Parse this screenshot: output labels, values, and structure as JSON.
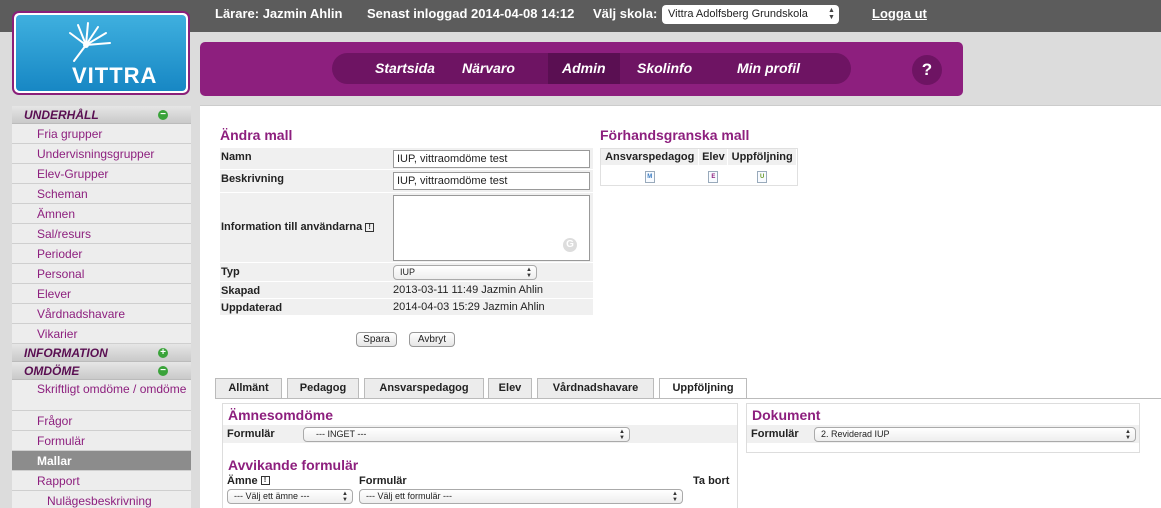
{
  "topbar": {
    "teacher": "Lärare: Jazmin Ahlin",
    "last_login": "Senast inloggad 2014-04-08 14:12",
    "school_label": "Välj skola:",
    "school_value": "Vittra Adolfsberg Grundskola",
    "logout": "Logga ut"
  },
  "logo": {
    "text": "VITTRA"
  },
  "nav": {
    "items": [
      "Startsida",
      "Närvaro",
      "Admin",
      "Skolinfo",
      "Min profil"
    ],
    "help": "?"
  },
  "sidebar": {
    "sections": [
      {
        "title": "UNDERHÅLL",
        "icon": "minus",
        "items": [
          "Fria grupper",
          "Undervisningsgrupper",
          "Elev-Grupper",
          "Scheman",
          "Ämnen",
          "Sal/resurs",
          "Perioder",
          "Personal",
          "Elever",
          "Vårdnadshavare",
          "Vikarier"
        ]
      },
      {
        "title": "INFORMATION",
        "icon": "plus",
        "items": []
      },
      {
        "title": "OMDÖME",
        "icon": "minus",
        "items": [
          "Skriftligt omdöme / omdöme",
          "Frågor",
          "Formulär",
          "Mallar",
          "Rapport",
          "Nulägesbeskrivning"
        ]
      }
    ],
    "active_item": "Mallar"
  },
  "edit": {
    "title": "Ändra mall",
    "name_label": "Namn",
    "name_value": "IUP, vittraomdöme test",
    "desc_label": "Beskrivning",
    "desc_value": "IUP, vittraomdöme test",
    "info_label": "Information till användarna",
    "info_icon": "!",
    "type_label": "Typ",
    "type_value": "IUP",
    "created_label": "Skapad",
    "created_value": "2013-03-11 11:49 Jazmin Ahlin",
    "updated_label": "Uppdaterad",
    "updated_value": "2014-04-03 15:29 Jazmin Ahlin",
    "save": "Spara",
    "cancel": "Avbryt"
  },
  "preview": {
    "title": "Förhandsgranska mall",
    "columns": [
      "Ansvarspedagog",
      "Elev",
      "Uppföljning"
    ],
    "letters": [
      "M",
      "E",
      "U"
    ]
  },
  "tabs": [
    "Allmänt",
    "Pedagog",
    "Ansvarspedagog",
    "Elev",
    "Vårdnadshavare",
    "Uppföljning"
  ],
  "active_tab": "Uppföljning",
  "subject": {
    "title": "Ämnesomdöme",
    "form_label": "Formulär",
    "form_value": "--- INGET ---"
  },
  "deviating": {
    "title": "Avvikande formulär",
    "col_subject": "Ämne",
    "col_form": "Formulär",
    "col_remove": "Ta bort",
    "subject_placeholder": "--- Välj ett ämne ---",
    "form_placeholder": "--- Välj ett formulär ---"
  },
  "document": {
    "title": "Dokument",
    "form_label": "Formulär",
    "form_value": "2. Reviderad IUP"
  }
}
